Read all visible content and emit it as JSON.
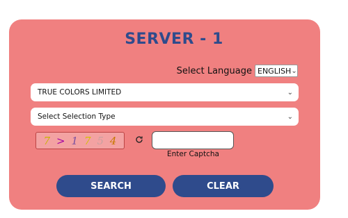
{
  "title": "SERVER - 1",
  "language": {
    "label": "Select Language",
    "selected": "ENGLISH"
  },
  "company_select": {
    "selected": "TRUE COLORS LIMITED"
  },
  "selection_type_select": {
    "selected": "Select Selection Type"
  },
  "captcha": {
    "chars": [
      "7",
      ">",
      "1",
      "7",
      "5",
      "4"
    ],
    "char_colors": [
      "#c8b400",
      "#a300a3",
      "#7a50a0",
      "#d4c000",
      "#c9a0a0",
      "#c77700"
    ],
    "refresh_icon": "refresh-icon",
    "input_label": "Enter Captcha"
  },
  "buttons": {
    "search": "SEARCH",
    "clear": "CLEAR"
  },
  "colors": {
    "card": "#f08080",
    "accent": "#2f4b8c"
  }
}
